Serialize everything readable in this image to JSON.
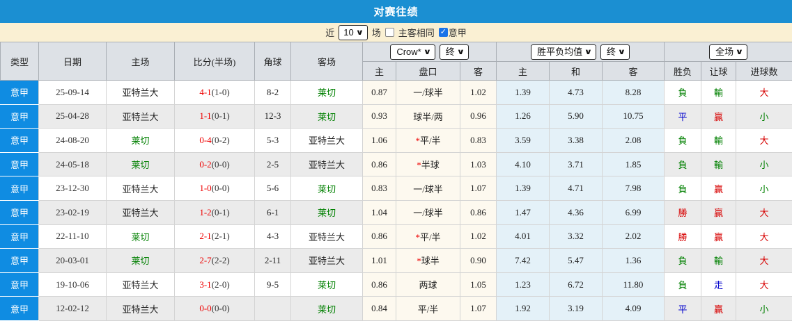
{
  "colors": {
    "titlebar": "#1b8fd2",
    "filterbar": "#faf0d3",
    "type_cell": "#0f8ce2",
    "odds_bg": "#fdf9ef",
    "avg_bg": "#e4f1f8",
    "stripe": "#ebebeb",
    "win_red": "#d70000",
    "lose_green": "#008000",
    "draw_blue": "#0000cc"
  },
  "title": "对赛往绩",
  "filter": {
    "near_label": "近",
    "count_value": "10",
    "games_label": "场",
    "same_venue_label": "主客相同",
    "same_venue_checked": false,
    "league_label": "意甲",
    "league_checked": true
  },
  "table": {
    "left_headers": [
      "类型",
      "日期",
      "主场",
      "比分(半场)",
      "角球",
      "客场"
    ],
    "groups": [
      {
        "dropdowns": [
          "Crow*",
          "终"
        ],
        "cols": [
          "主",
          "盘口",
          "客"
        ]
      },
      {
        "dropdowns": [
          "胜平负均值",
          "终"
        ],
        "cols": [
          "主",
          "和",
          "客"
        ]
      },
      {
        "dropdowns": [
          "全场"
        ],
        "cols": [
          "胜负",
          "让球",
          "进球数"
        ]
      }
    ],
    "rows": [
      {
        "type": "意甲",
        "date": "25-09-14",
        "home": "亚特兰大",
        "home_color": "black",
        "score": "4-1",
        "half": "(1-0)",
        "corner": "8-2",
        "away": "莱切",
        "away_color": "green",
        "odds_home": "0.87",
        "star": "",
        "handicap": "一/球半",
        "odds_away": "1.02",
        "avg_home": "1.39",
        "avg_draw": "4.73",
        "avg_away": "8.28",
        "result": "負",
        "result_color": "green",
        "handicap_result": "輸",
        "handicap_result_color": "green",
        "goals": "大",
        "goals_color": "red"
      },
      {
        "type": "意甲",
        "date": "25-04-28",
        "home": "亚特兰大",
        "home_color": "black",
        "score": "1-1",
        "half": "(0-1)",
        "corner": "12-3",
        "away": "莱切",
        "away_color": "green",
        "odds_home": "0.93",
        "star": "",
        "handicap": "球半/两",
        "odds_away": "0.96",
        "avg_home": "1.26",
        "avg_draw": "5.90",
        "avg_away": "10.75",
        "result": "平",
        "result_color": "blue",
        "handicap_result": "贏",
        "handicap_result_color": "red",
        "goals": "小",
        "goals_color": "green"
      },
      {
        "type": "意甲",
        "date": "24-08-20",
        "home": "莱切",
        "home_color": "green",
        "score": "0-4",
        "half": "(0-2)",
        "corner": "5-3",
        "away": "亚特兰大",
        "away_color": "black",
        "odds_home": "1.06",
        "star": "*",
        "handicap": "平/半",
        "odds_away": "0.83",
        "avg_home": "3.59",
        "avg_draw": "3.38",
        "avg_away": "2.08",
        "result": "負",
        "result_color": "green",
        "handicap_result": "輸",
        "handicap_result_color": "green",
        "goals": "大",
        "goals_color": "red"
      },
      {
        "type": "意甲",
        "date": "24-05-18",
        "home": "莱切",
        "home_color": "green",
        "score": "0-2",
        "half": "(0-0)",
        "corner": "2-5",
        "away": "亚特兰大",
        "away_color": "black",
        "odds_home": "0.86",
        "star": "*",
        "handicap": "半球",
        "odds_away": "1.03",
        "avg_home": "4.10",
        "avg_draw": "3.71",
        "avg_away": "1.85",
        "result": "負",
        "result_color": "green",
        "handicap_result": "輸",
        "handicap_result_color": "green",
        "goals": "小",
        "goals_color": "green"
      },
      {
        "type": "意甲",
        "date": "23-12-30",
        "home": "亚特兰大",
        "home_color": "black",
        "score": "1-0",
        "half": "(0-0)",
        "corner": "5-6",
        "away": "莱切",
        "away_color": "green",
        "odds_home": "0.83",
        "star": "",
        "handicap": "一/球半",
        "odds_away": "1.07",
        "avg_home": "1.39",
        "avg_draw": "4.71",
        "avg_away": "7.98",
        "result": "負",
        "result_color": "green",
        "handicap_result": "贏",
        "handicap_result_color": "red",
        "goals": "小",
        "goals_color": "green"
      },
      {
        "type": "意甲",
        "date": "23-02-19",
        "home": "亚特兰大",
        "home_color": "black",
        "score": "1-2",
        "half": "(0-1)",
        "corner": "6-1",
        "away": "莱切",
        "away_color": "green",
        "odds_home": "1.04",
        "star": "",
        "handicap": "一/球半",
        "odds_away": "0.86",
        "avg_home": "1.47",
        "avg_draw": "4.36",
        "avg_away": "6.99",
        "result": "勝",
        "result_color": "red",
        "handicap_result": "贏",
        "handicap_result_color": "red",
        "goals": "大",
        "goals_color": "red"
      },
      {
        "type": "意甲",
        "date": "22-11-10",
        "home": "莱切",
        "home_color": "green",
        "score": "2-1",
        "half": "(2-1)",
        "corner": "4-3",
        "away": "亚特兰大",
        "away_color": "black",
        "odds_home": "0.86",
        "star": "*",
        "handicap": "平/半",
        "odds_away": "1.02",
        "avg_home": "4.01",
        "avg_draw": "3.32",
        "avg_away": "2.02",
        "result": "勝",
        "result_color": "red",
        "handicap_result": "贏",
        "handicap_result_color": "red",
        "goals": "大",
        "goals_color": "red"
      },
      {
        "type": "意甲",
        "date": "20-03-01",
        "home": "莱切",
        "home_color": "green",
        "score": "2-7",
        "half": "(2-2)",
        "corner": "2-11",
        "away": "亚特兰大",
        "away_color": "black",
        "odds_home": "1.01",
        "star": "*",
        "handicap": "球半",
        "odds_away": "0.90",
        "avg_home": "7.42",
        "avg_draw": "5.47",
        "avg_away": "1.36",
        "result": "負",
        "result_color": "green",
        "handicap_result": "輸",
        "handicap_result_color": "green",
        "goals": "大",
        "goals_color": "red"
      },
      {
        "type": "意甲",
        "date": "19-10-06",
        "home": "亚特兰大",
        "home_color": "black",
        "score": "3-1",
        "half": "(2-0)",
        "corner": "9-5",
        "away": "莱切",
        "away_color": "green",
        "odds_home": "0.86",
        "star": "",
        "handicap": "两球",
        "odds_away": "1.05",
        "avg_home": "1.23",
        "avg_draw": "6.72",
        "avg_away": "11.80",
        "result": "負",
        "result_color": "green",
        "handicap_result": "走",
        "handicap_result_color": "blue",
        "goals": "大",
        "goals_color": "red"
      },
      {
        "type": "意甲",
        "date": "12-02-12",
        "home": "亚特兰大",
        "home_color": "black",
        "score": "0-0",
        "half": "(0-0)",
        "corner": "",
        "away": "莱切",
        "away_color": "green",
        "odds_home": "0.84",
        "star": "",
        "handicap": "平/半",
        "odds_away": "1.07",
        "avg_home": "1.92",
        "avg_draw": "3.19",
        "avg_away": "4.09",
        "result": "平",
        "result_color": "blue",
        "handicap_result": "贏",
        "handicap_result_color": "red",
        "goals": "小",
        "goals_color": "green"
      }
    ]
  }
}
